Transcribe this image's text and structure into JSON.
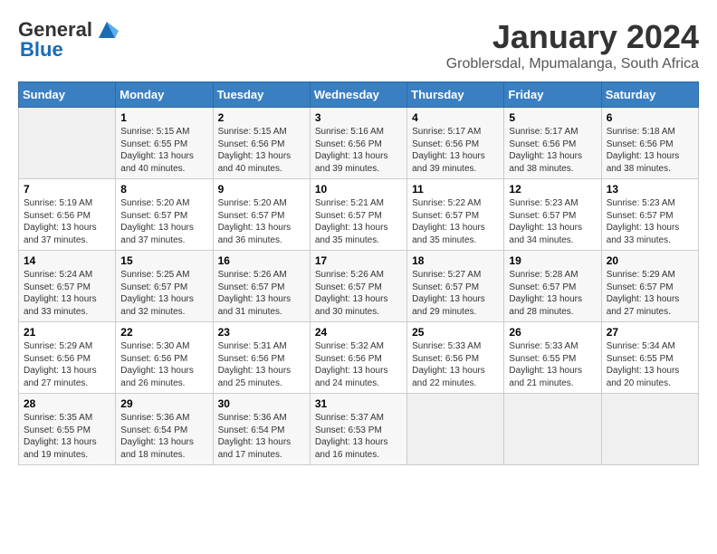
{
  "header": {
    "logo_line1": "General",
    "logo_line2": "Blue",
    "month_title": "January 2024",
    "location": "Groblersdal, Mpumalanga, South Africa"
  },
  "calendar": {
    "days_of_week": [
      "Sunday",
      "Monday",
      "Tuesday",
      "Wednesday",
      "Thursday",
      "Friday",
      "Saturday"
    ],
    "weeks": [
      [
        {
          "day": "",
          "info": ""
        },
        {
          "day": "1",
          "info": "Sunrise: 5:15 AM\nSunset: 6:55 PM\nDaylight: 13 hours\nand 40 minutes."
        },
        {
          "day": "2",
          "info": "Sunrise: 5:15 AM\nSunset: 6:56 PM\nDaylight: 13 hours\nand 40 minutes."
        },
        {
          "day": "3",
          "info": "Sunrise: 5:16 AM\nSunset: 6:56 PM\nDaylight: 13 hours\nand 39 minutes."
        },
        {
          "day": "4",
          "info": "Sunrise: 5:17 AM\nSunset: 6:56 PM\nDaylight: 13 hours\nand 39 minutes."
        },
        {
          "day": "5",
          "info": "Sunrise: 5:17 AM\nSunset: 6:56 PM\nDaylight: 13 hours\nand 38 minutes."
        },
        {
          "day": "6",
          "info": "Sunrise: 5:18 AM\nSunset: 6:56 PM\nDaylight: 13 hours\nand 38 minutes."
        }
      ],
      [
        {
          "day": "7",
          "info": "Sunrise: 5:19 AM\nSunset: 6:56 PM\nDaylight: 13 hours\nand 37 minutes."
        },
        {
          "day": "8",
          "info": "Sunrise: 5:20 AM\nSunset: 6:57 PM\nDaylight: 13 hours\nand 37 minutes."
        },
        {
          "day": "9",
          "info": "Sunrise: 5:20 AM\nSunset: 6:57 PM\nDaylight: 13 hours\nand 36 minutes."
        },
        {
          "day": "10",
          "info": "Sunrise: 5:21 AM\nSunset: 6:57 PM\nDaylight: 13 hours\nand 35 minutes."
        },
        {
          "day": "11",
          "info": "Sunrise: 5:22 AM\nSunset: 6:57 PM\nDaylight: 13 hours\nand 35 minutes."
        },
        {
          "day": "12",
          "info": "Sunrise: 5:23 AM\nSunset: 6:57 PM\nDaylight: 13 hours\nand 34 minutes."
        },
        {
          "day": "13",
          "info": "Sunrise: 5:23 AM\nSunset: 6:57 PM\nDaylight: 13 hours\nand 33 minutes."
        }
      ],
      [
        {
          "day": "14",
          "info": "Sunrise: 5:24 AM\nSunset: 6:57 PM\nDaylight: 13 hours\nand 33 minutes."
        },
        {
          "day": "15",
          "info": "Sunrise: 5:25 AM\nSunset: 6:57 PM\nDaylight: 13 hours\nand 32 minutes."
        },
        {
          "day": "16",
          "info": "Sunrise: 5:26 AM\nSunset: 6:57 PM\nDaylight: 13 hours\nand 31 minutes."
        },
        {
          "day": "17",
          "info": "Sunrise: 5:26 AM\nSunset: 6:57 PM\nDaylight: 13 hours\nand 30 minutes."
        },
        {
          "day": "18",
          "info": "Sunrise: 5:27 AM\nSunset: 6:57 PM\nDaylight: 13 hours\nand 29 minutes."
        },
        {
          "day": "19",
          "info": "Sunrise: 5:28 AM\nSunset: 6:57 PM\nDaylight: 13 hours\nand 28 minutes."
        },
        {
          "day": "20",
          "info": "Sunrise: 5:29 AM\nSunset: 6:57 PM\nDaylight: 13 hours\nand 27 minutes."
        }
      ],
      [
        {
          "day": "21",
          "info": "Sunrise: 5:29 AM\nSunset: 6:56 PM\nDaylight: 13 hours\nand 27 minutes."
        },
        {
          "day": "22",
          "info": "Sunrise: 5:30 AM\nSunset: 6:56 PM\nDaylight: 13 hours\nand 26 minutes."
        },
        {
          "day": "23",
          "info": "Sunrise: 5:31 AM\nSunset: 6:56 PM\nDaylight: 13 hours\nand 25 minutes."
        },
        {
          "day": "24",
          "info": "Sunrise: 5:32 AM\nSunset: 6:56 PM\nDaylight: 13 hours\nand 24 minutes."
        },
        {
          "day": "25",
          "info": "Sunrise: 5:33 AM\nSunset: 6:56 PM\nDaylight: 13 hours\nand 22 minutes."
        },
        {
          "day": "26",
          "info": "Sunrise: 5:33 AM\nSunset: 6:55 PM\nDaylight: 13 hours\nand 21 minutes."
        },
        {
          "day": "27",
          "info": "Sunrise: 5:34 AM\nSunset: 6:55 PM\nDaylight: 13 hours\nand 20 minutes."
        }
      ],
      [
        {
          "day": "28",
          "info": "Sunrise: 5:35 AM\nSunset: 6:55 PM\nDaylight: 13 hours\nand 19 minutes."
        },
        {
          "day": "29",
          "info": "Sunrise: 5:36 AM\nSunset: 6:54 PM\nDaylight: 13 hours\nand 18 minutes."
        },
        {
          "day": "30",
          "info": "Sunrise: 5:36 AM\nSunset: 6:54 PM\nDaylight: 13 hours\nand 17 minutes."
        },
        {
          "day": "31",
          "info": "Sunrise: 5:37 AM\nSunset: 6:53 PM\nDaylight: 13 hours\nand 16 minutes."
        },
        {
          "day": "",
          "info": ""
        },
        {
          "day": "",
          "info": ""
        },
        {
          "day": "",
          "info": ""
        }
      ]
    ]
  }
}
